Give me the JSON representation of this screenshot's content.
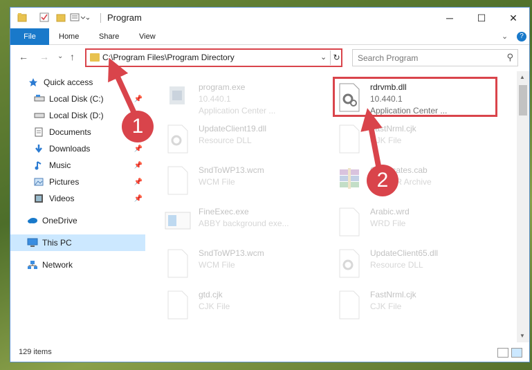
{
  "window": {
    "title": "Program",
    "controls": {
      "minimize": "─",
      "maximize": "☐",
      "close": "✕"
    }
  },
  "ribbon": {
    "tabs": [
      "File",
      "Home",
      "Share",
      "View"
    ]
  },
  "address": {
    "path": "C:\\Program Files\\Program Directory",
    "search_placeholder": "Search Program"
  },
  "nav": {
    "items": [
      {
        "label": "Quick access",
        "icon": "star-icon",
        "pinned": false
      },
      {
        "label": "Local Disk (C:)",
        "icon": "drive-icon",
        "pinned": true
      },
      {
        "label": "Local Disk (D:)",
        "icon": "drive-icon",
        "pinned": false
      },
      {
        "label": "Documents",
        "icon": "documents-icon",
        "pinned": false
      },
      {
        "label": "Downloads",
        "icon": "download-icon",
        "pinned": true
      },
      {
        "label": "Music",
        "icon": "music-icon",
        "pinned": true
      },
      {
        "label": "Pictures",
        "icon": "pictures-icon",
        "pinned": true
      },
      {
        "label": "Videos",
        "icon": "videos-icon",
        "pinned": true
      },
      {
        "label": "OneDrive",
        "icon": "cloud-icon",
        "pinned": false
      },
      {
        "label": "This PC",
        "icon": "pc-icon",
        "pinned": false,
        "selected": true
      },
      {
        "label": "Network",
        "icon": "network-icon",
        "pinned": false
      }
    ]
  },
  "files": [
    {
      "name": "program.exe",
      "line2": "10.440.1",
      "line3": "Application Center ...",
      "icon": "exe-icon",
      "faded": true
    },
    {
      "name": "rdrvmb.dll",
      "line2": "10.440.1",
      "line3": "Application Center ...",
      "icon": "dll-gear-icon",
      "faded": false,
      "highlighted": true
    },
    {
      "name": "UpdateClient19.dll",
      "line2": "Resource DLL",
      "line3": "",
      "icon": "dll-gear-icon",
      "faded": true
    },
    {
      "name": "FastNrml.cjk",
      "line2": "CJK File",
      "line3": "",
      "icon": "file-icon",
      "faded": true
    },
    {
      "name": "SndToWP13.wcm",
      "line2": "WCM File",
      "line3": "",
      "icon": "file-icon",
      "faded": true
    },
    {
      "name": "Certificates.cab",
      "line2": "WinRAR Archive",
      "line3": "",
      "icon": "archive-icon",
      "faded": true
    },
    {
      "name": "FineExec.exe",
      "line2": "ABBY background exe...",
      "line3": "",
      "icon": "exe-icon",
      "faded": true
    },
    {
      "name": "Arabic.wrd",
      "line2": "WRD File",
      "line3": "",
      "icon": "file-icon",
      "faded": true
    },
    {
      "name": "SndToWP13.wcm",
      "line2": "WCM File",
      "line3": "",
      "icon": "file-icon",
      "faded": true
    },
    {
      "name": "UpdateClient65.dll",
      "line2": "Resource DLL",
      "line3": "",
      "icon": "dll-gear-icon",
      "faded": true
    },
    {
      "name": "gtd.cjk",
      "line2": "CJK File",
      "line3": "",
      "icon": "file-icon",
      "faded": true
    },
    {
      "name": "FastNrml.cjk",
      "line2": "CJK File",
      "line3": "",
      "icon": "file-icon",
      "faded": true
    }
  ],
  "status": {
    "items_count": "129 items"
  },
  "annotations": {
    "badge1": "1",
    "badge2": "2",
    "color": "#d9444b"
  },
  "colors": {
    "accent": "#1979ca",
    "highlight": "#d9444b",
    "selection": "#cce8ff"
  }
}
